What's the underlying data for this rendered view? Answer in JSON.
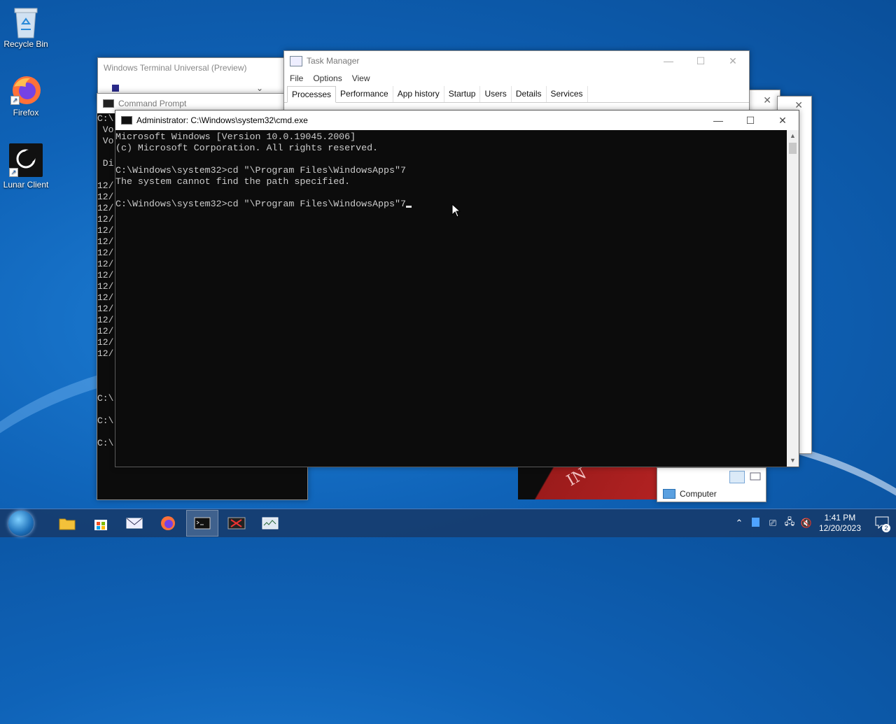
{
  "desktop": {
    "icons": [
      {
        "label": "Recycle Bin"
      },
      {
        "label": "Firefox"
      },
      {
        "label": "Lunar Client"
      }
    ]
  },
  "windows": {
    "terminal": {
      "title": "Windows Terminal Universal (Preview)"
    },
    "cmd_background": {
      "title": "Command Prompt",
      "lines": [
        "C:\\",
        " Vo",
        " Vo",
        "",
        " Di",
        "",
        "12/",
        "12/",
        "12/",
        "12/",
        "12/",
        "12/",
        "12/",
        "12/",
        "12/",
        "12/",
        "12/",
        "12/",
        "12/",
        "12/",
        "12/",
        "12/",
        "",
        "",
        "",
        "C:\\",
        "",
        "C:\\",
        "",
        "C:\\"
      ]
    },
    "task_manager": {
      "title": "Task Manager",
      "menu": [
        "File",
        "Options",
        "View"
      ],
      "tabs": [
        "Processes",
        "Performance",
        "App history",
        "Startup",
        "Users",
        "Details",
        "Services"
      ],
      "active_tab": "Processes"
    },
    "explorer_status": {
      "item": "Computer"
    },
    "cmd_admin": {
      "title": "Administrator: C:\\Windows\\system32\\cmd.exe",
      "lines": [
        "Microsoft Windows [Version 10.0.19045.2006]",
        "(c) Microsoft Corporation. All rights reserved.",
        "",
        "C:\\Windows\\system32>cd \"\\Program Files\\WindowsApps\"7",
        "The system cannot find the path specified.",
        ""
      ],
      "current_input": "C:\\Windows\\system32>cd \"\\Program Files\\WindowsApps\"7"
    }
  },
  "taskbar": {
    "apps": [
      "file-explorer",
      "store",
      "mail",
      "firefox",
      "command-prompt",
      "tool-app",
      "task-manager"
    ],
    "active_app": "command-prompt",
    "clock_time": "1:41 PM",
    "clock_date": "12/20/2023",
    "notification_count": "2"
  },
  "colors": {
    "terminal_bg": "#0c0c0c",
    "terminal_fg": "#cccccc",
    "taskbar": "#163c6e"
  }
}
